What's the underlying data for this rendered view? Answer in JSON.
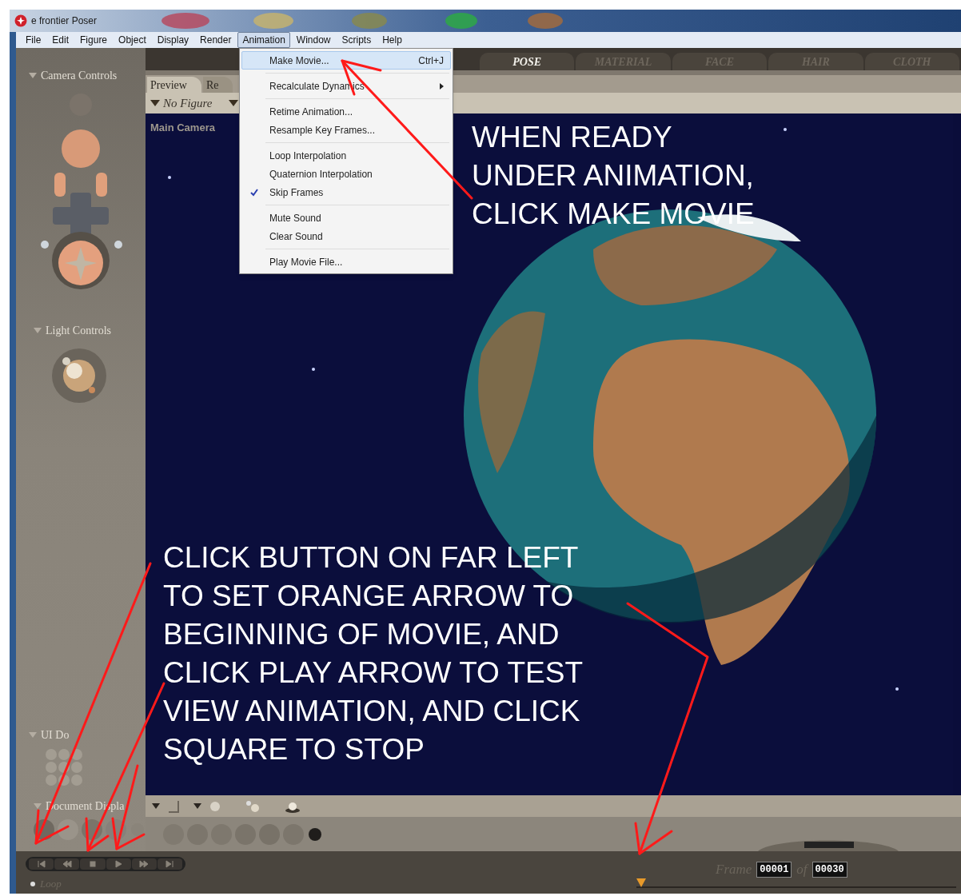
{
  "window": {
    "title": "e frontier Poser"
  },
  "menu_bar": [
    {
      "label": "File",
      "selected": false
    },
    {
      "label": "Edit",
      "selected": false
    },
    {
      "label": "Figure",
      "selected": false
    },
    {
      "label": "Object",
      "selected": false
    },
    {
      "label": "Display",
      "selected": false
    },
    {
      "label": "Render",
      "selected": false
    },
    {
      "label": "Animation",
      "selected": true
    },
    {
      "label": "Window",
      "selected": false
    },
    {
      "label": "Scripts",
      "selected": false
    },
    {
      "label": "Help",
      "selected": false
    }
  ],
  "animation_menu": [
    {
      "kind": "item",
      "label": "Make Movie...",
      "shortcut": "Ctrl+J",
      "selected": true,
      "checked": false,
      "submenu": false
    },
    {
      "kind": "separator"
    },
    {
      "kind": "item",
      "label": "Recalculate Dynamics",
      "selected": false,
      "checked": false,
      "submenu": true
    },
    {
      "kind": "separator"
    },
    {
      "kind": "item",
      "label": "Retime Animation...",
      "selected": false,
      "checked": false,
      "submenu": false
    },
    {
      "kind": "item",
      "label": "Resample Key Frames...",
      "selected": false,
      "checked": false,
      "submenu": false
    },
    {
      "kind": "separator"
    },
    {
      "kind": "item",
      "label": "Loop Interpolation",
      "selected": false,
      "checked": false,
      "submenu": false
    },
    {
      "kind": "item",
      "label": "Quaternion Interpolation",
      "selected": false,
      "checked": false,
      "submenu": false
    },
    {
      "kind": "item",
      "label": "Skip Frames",
      "selected": false,
      "checked": true,
      "submenu": false
    },
    {
      "kind": "separator"
    },
    {
      "kind": "item",
      "label": "Mute Sound",
      "selected": false,
      "checked": false,
      "submenu": false
    },
    {
      "kind": "item",
      "label": "Clear Sound",
      "selected": false,
      "checked": false,
      "submenu": false
    },
    {
      "kind": "separator"
    },
    {
      "kind": "item",
      "label": "Play Movie File...",
      "selected": false,
      "checked": false,
      "submenu": false
    }
  ],
  "room_tabs": [
    {
      "label": "POSE",
      "selected": true
    },
    {
      "label": "MATERIAL",
      "selected": false
    },
    {
      "label": "FACE",
      "selected": false
    },
    {
      "label": "HAIR",
      "selected": false
    },
    {
      "label": "CLOTH",
      "selected": false
    }
  ],
  "left_panel": [
    {
      "kind": "camera",
      "title": "Camera Controls"
    },
    {
      "kind": "light",
      "title": "Light Controls"
    },
    {
      "kind": "dots",
      "title": "UI Do"
    },
    {
      "kind": "display",
      "title": "Document Displa"
    }
  ],
  "document": {
    "tabs": [
      {
        "label": "Preview",
        "selected": true
      },
      {
        "label": "Re",
        "selected": false
      }
    ],
    "figure_dropdown": "No Figure",
    "camera_label": "Main Camera"
  },
  "annotations": [
    {
      "lines": [
        "WHEN READY",
        "UNDER ANIMATION,",
        "CLICK MAKE MOVIE"
      ]
    },
    {
      "lines": [
        "CLICK BUTTON ON FAR LEFT",
        "TO SET ORANGE ARROW TO",
        "BEGINNING OF MOVIE, AND",
        "CLICK PLAY ARROW TO TEST",
        "VIEW ANIMATION, AND CLICK",
        "SQUARE TO STOP"
      ]
    }
  ],
  "playback": {
    "buttons": [
      {
        "kind": "to-start"
      },
      {
        "kind": "step-back"
      },
      {
        "kind": "stop"
      },
      {
        "kind": "play"
      },
      {
        "kind": "step-forward"
      },
      {
        "kind": "to-end"
      }
    ],
    "loop_label": "Loop"
  },
  "frame": {
    "label": "Frame",
    "current": "00001",
    "separator": "of",
    "total": "00030"
  },
  "timeline": {
    "level": 0
  }
}
